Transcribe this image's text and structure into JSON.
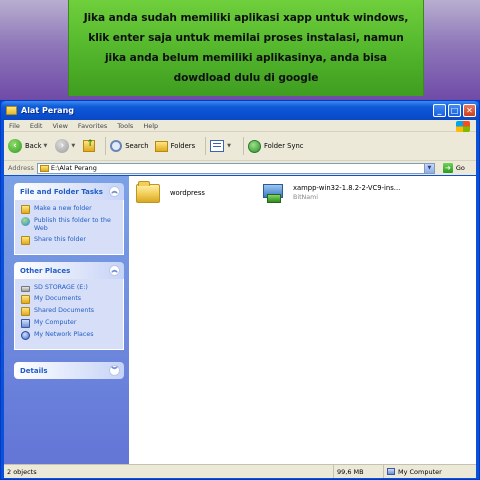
{
  "caption": {
    "text": "Jika anda sudah memiliki aplikasi xapp untuk windows, klik enter saja untuk memilai proses instalasi, namun jika anda belum memiliki aplikasinya, anda bisa dowdload dulu di google"
  },
  "window": {
    "title": "Alat Perang",
    "buttons": {
      "minimize": "_",
      "maximize": "□",
      "close": "✕"
    }
  },
  "menu": [
    "File",
    "Edit",
    "View",
    "Favorites",
    "Tools",
    "Help"
  ],
  "toolbar": {
    "back": "Back",
    "search": "Search",
    "folders": "Folders",
    "folder_sync": "Folder Sync"
  },
  "address": {
    "label": "Address",
    "value": "E:\\Alat Perang",
    "go": "Go"
  },
  "taskpane": {
    "file_tasks": {
      "title": "File and Folder Tasks",
      "items": [
        {
          "label": "Make a new folder",
          "icon": "new-folder-icon"
        },
        {
          "label": "Publish this folder to the Web",
          "icon": "publish-web-icon"
        },
        {
          "label": "Share this folder",
          "icon": "share-folder-icon"
        }
      ]
    },
    "other_places": {
      "title": "Other Places",
      "items": [
        {
          "label": "SD STORAGE (E:)",
          "icon": "drive-icon"
        },
        {
          "label": "My Documents",
          "icon": "my-documents-icon"
        },
        {
          "label": "Shared Documents",
          "icon": "shared-documents-icon"
        },
        {
          "label": "My Computer",
          "icon": "my-computer-icon"
        },
        {
          "label": "My Network Places",
          "icon": "network-places-icon"
        }
      ]
    },
    "details": {
      "title": "Details"
    }
  },
  "files": [
    {
      "name": "wordpress",
      "type": "folder"
    },
    {
      "name": "xampp-win32-1.8.2-2-VC9-ins...",
      "publisher": "BitNami",
      "type": "installer"
    }
  ],
  "status": {
    "count": "2 objects",
    "size": "99,6 MB",
    "location": "My Computer"
  },
  "colors": {
    "caption_bg": "#52b52b",
    "titlebar": "#0a4fd0",
    "link_blue": "#215dc6"
  }
}
